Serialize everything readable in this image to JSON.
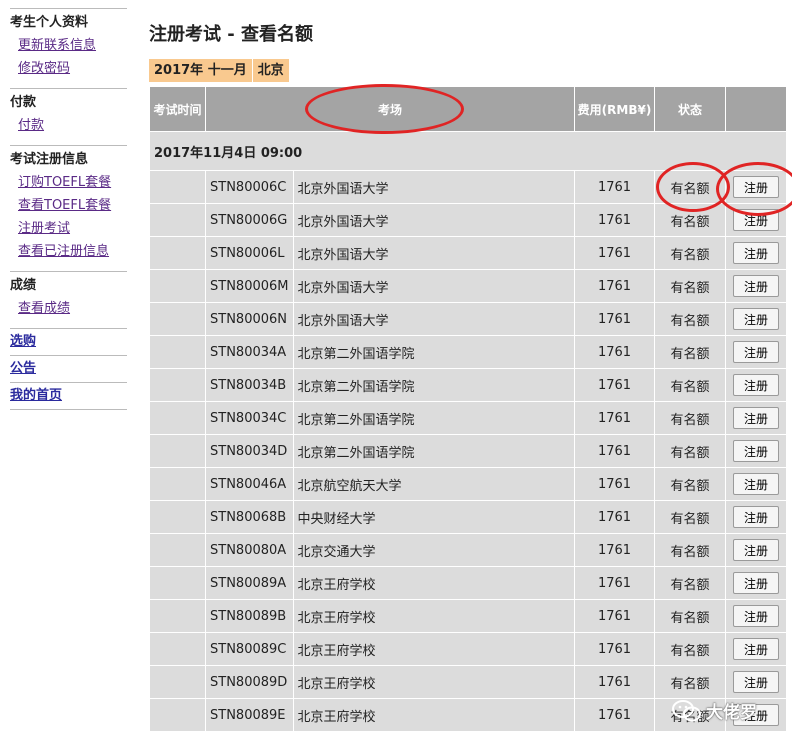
{
  "sidebar": {
    "profile": {
      "heading": "考生个人资料",
      "links": [
        "更新联系信息",
        "修改密码"
      ]
    },
    "payment": {
      "heading": "付款",
      "links": [
        "付款"
      ]
    },
    "registration": {
      "heading": "考试注册信息",
      "links": [
        "订购TOEFL套餐",
        "查看TOEFL套餐",
        "注册考试",
        "查看已注册信息"
      ]
    },
    "scores": {
      "heading": "成绩",
      "links": [
        "查看成绩"
      ]
    },
    "top_links": [
      "选购",
      "公告",
      "我的首页"
    ]
  },
  "page_title": "注册考试 - 查看名额",
  "crumbs": [
    "2017年 十一月",
    "北京"
  ],
  "table": {
    "headers": {
      "time": "考试时间",
      "center": "考场",
      "fee": "费用(RMB¥)",
      "status": "状态",
      "action": ""
    },
    "date_label": "2017年11月4日 09:00",
    "register_label": "注册",
    "rows": [
      {
        "code": "STN80006C",
        "center": "北京外国语大学",
        "fee": "1761",
        "status": "有名额"
      },
      {
        "code": "STN80006G",
        "center": "北京外国语大学",
        "fee": "1761",
        "status": "有名额"
      },
      {
        "code": "STN80006L",
        "center": "北京外国语大学",
        "fee": "1761",
        "status": "有名额"
      },
      {
        "code": "STN80006M",
        "center": "北京外国语大学",
        "fee": "1761",
        "status": "有名额"
      },
      {
        "code": "STN80006N",
        "center": "北京外国语大学",
        "fee": "1761",
        "status": "有名额"
      },
      {
        "code": "STN80034A",
        "center": "北京第二外国语学院",
        "fee": "1761",
        "status": "有名额"
      },
      {
        "code": "STN80034B",
        "center": "北京第二外国语学院",
        "fee": "1761",
        "status": "有名额"
      },
      {
        "code": "STN80034C",
        "center": "北京第二外国语学院",
        "fee": "1761",
        "status": "有名额"
      },
      {
        "code": "STN80034D",
        "center": "北京第二外国语学院",
        "fee": "1761",
        "status": "有名额"
      },
      {
        "code": "STN80046A",
        "center": "北京航空航天大学",
        "fee": "1761",
        "status": "有名额"
      },
      {
        "code": "STN80068B",
        "center": "中央财经大学",
        "fee": "1761",
        "status": "有名额"
      },
      {
        "code": "STN80080A",
        "center": "北京交通大学",
        "fee": "1761",
        "status": "有名额"
      },
      {
        "code": "STN80089A",
        "center": "北京王府学校",
        "fee": "1761",
        "status": "有名额"
      },
      {
        "code": "STN80089B",
        "center": "北京王府学校",
        "fee": "1761",
        "status": "有名额"
      },
      {
        "code": "STN80089C",
        "center": "北京王府学校",
        "fee": "1761",
        "status": "有名额"
      },
      {
        "code": "STN80089D",
        "center": "北京王府学校",
        "fee": "1761",
        "status": "有名额"
      },
      {
        "code": "STN80089E",
        "center": "北京王府学校",
        "fee": "1761",
        "status": "有名额"
      }
    ]
  },
  "watermark": {
    "text": "大佬罗",
    "icon": "wechat-icon"
  },
  "colors": {
    "header_bg": "#a4a4a4",
    "row_bg": "#dcdcdc",
    "crumb_bg": "#f9c98f",
    "link": "#5a2a86",
    "annotation": "#e02424"
  }
}
